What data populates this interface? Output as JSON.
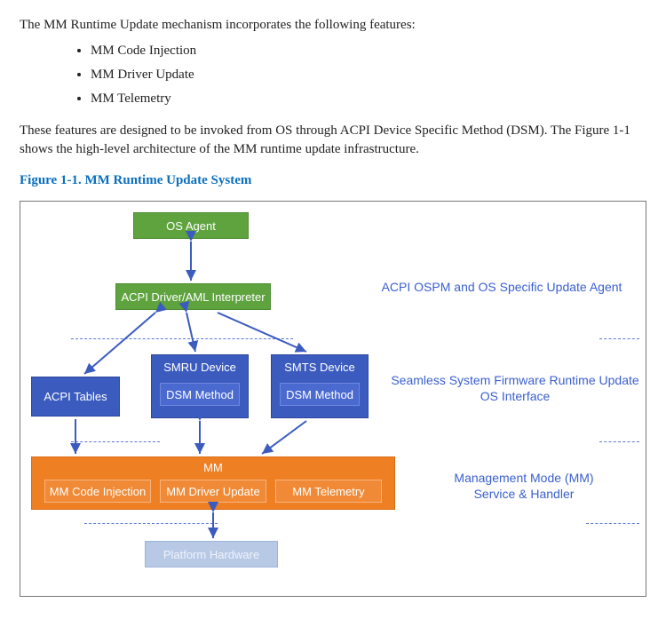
{
  "intro": "The MM Runtime Update mechanism incorporates the following features:",
  "features": [
    "MM Code Injection",
    "MM Driver Update",
    "MM Telemetry"
  ],
  "desc": "These features are designed to be invoked from OS through ACPI Device Specific Method (DSM). The Figure 1-1 shows the high-level architecture of the MM runtime update infrastructure.",
  "figcap": "Figure 1-1. MM Runtime Update System",
  "diagram": {
    "os_agent": "OS Agent",
    "acpi_driver": "ACPI Driver/AML Interpreter",
    "acpi_tables": "ACPI Tables",
    "smru": "SMRU Device",
    "smts": "SMTS Device",
    "dsm": "DSM Method",
    "mm": "MM",
    "mm_code": "MM Code Injection",
    "mm_driver": "MM Driver Update",
    "mm_telemetry": "MM Telemetry",
    "platform": "Platform Hardware",
    "label_top": "ACPI OSPM and OS Specific Update Agent",
    "label_mid1": "Seamless System Firmware Runtime Update",
    "label_mid2": "OS Interface",
    "label_mm1": "Management Mode (MM)",
    "label_mm2": "Service & Handler"
  }
}
